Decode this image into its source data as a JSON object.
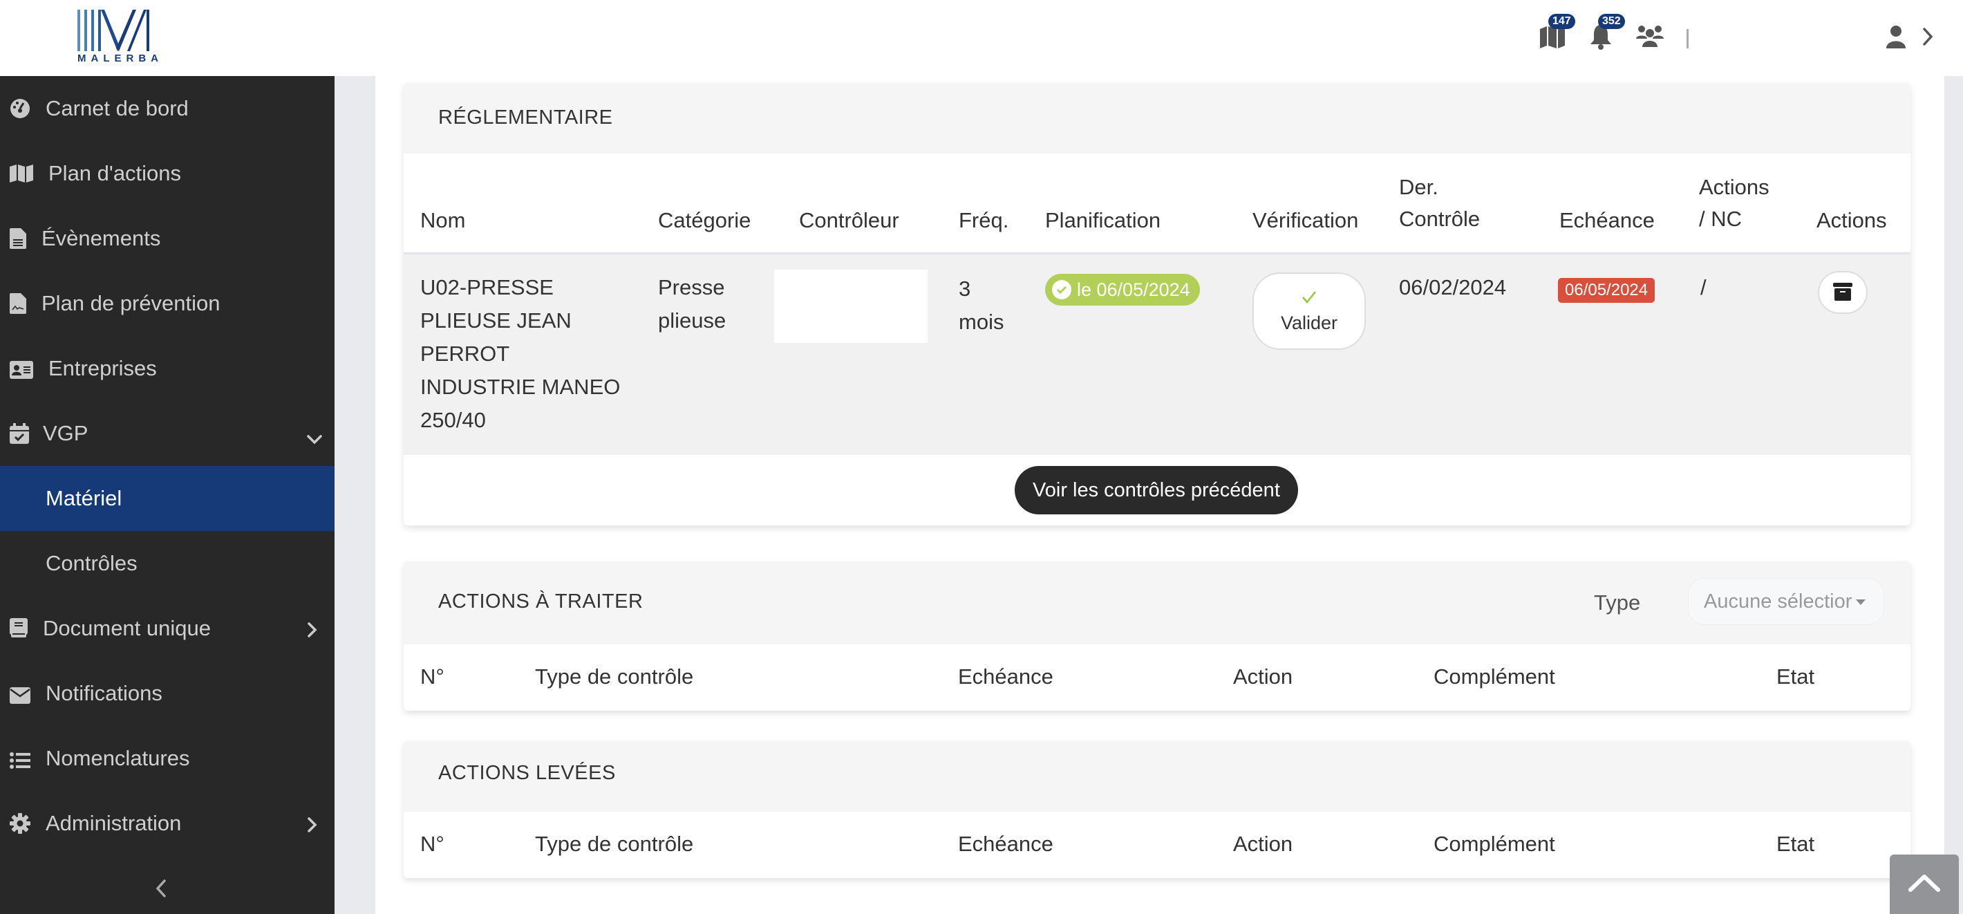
{
  "header": {
    "logo_text": "MALERBA",
    "icons": [
      {
        "name": "map-icon",
        "badge": "147"
      },
      {
        "name": "bell-icon",
        "badge": "352"
      },
      {
        "name": "users-icon",
        "badge": null
      }
    ],
    "user_icon": "user-icon",
    "user_chevron": "chevron-right-icon"
  },
  "sidebar": {
    "items": [
      {
        "label": "Carnet de bord",
        "icon": "dashboard-icon"
      },
      {
        "label": "Plan d'actions",
        "icon": "map-icon"
      },
      {
        "label": "Évènements",
        "icon": "file-text-icon"
      },
      {
        "label": "Plan de prévention",
        "icon": "file-signature-icon"
      },
      {
        "label": "Entreprises",
        "icon": "id-card-icon"
      },
      {
        "label": "VGP",
        "icon": "calendar-check-icon",
        "expanded": true
      },
      {
        "label": "Matériel",
        "sub": true,
        "active": true
      },
      {
        "label": "Contrôles",
        "sub": true
      },
      {
        "label": "Document unique",
        "icon": "book-icon",
        "has_children": true
      },
      {
        "label": "Notifications",
        "icon": "envelope-icon"
      },
      {
        "label": "Nomenclatures",
        "icon": "list-icon"
      },
      {
        "label": "Administration",
        "icon": "gear-icon",
        "has_children": true
      }
    ],
    "collapse_icon": "chevron-left-icon"
  },
  "reglementaire": {
    "title": "RÉGLEMENTAIRE",
    "columns": [
      "Nom",
      "Catégorie",
      "Contrôleur",
      "Fréq.",
      "Planification",
      "Vérification",
      "Der.\nContrôle",
      "Echéance",
      "Actions\n/ NC",
      "Actions"
    ],
    "row": {
      "nom": "U02-PRESSE PLIEUSE JEAN PERROT INDUSTRIE MANEO 250/40",
      "nom_lines": [
        "U02-PRESSE",
        "PLIEUSE JEAN",
        "PERROT",
        "INDUSTRIE MANEO",
        "250/40"
      ],
      "categorie_lines": [
        "Presse",
        "plieuse"
      ],
      "controleur": "",
      "freq_lines": [
        "3",
        "mois"
      ],
      "planification": "le 06/05/2024",
      "verification_label": "Valider",
      "der_controle": "06/02/2024",
      "echeance": "06/05/2024",
      "actions_nc": "/",
      "actions_icon": "archive-icon"
    },
    "footer_button": "Voir les contrôles précédent",
    "colors": {
      "planification_badge": "#b2d057",
      "echeance_badge": "#d94f3d"
    }
  },
  "actions_a_traiter": {
    "title": "ACTIONS À TRAITER",
    "type_label": "Type",
    "type_select_value": "Aucune sélection",
    "type_select_display": "Aucune sélectior",
    "columns": [
      "N°",
      "Type de contrôle",
      "Echéance",
      "Action",
      "Complément",
      "Etat"
    ]
  },
  "actions_levees": {
    "title": "ACTIONS LEVÉES",
    "columns": [
      "N°",
      "Type de contrôle",
      "Echéance",
      "Action",
      "Complément",
      "Etat"
    ]
  },
  "scroll_top_icon": "chevron-up-icon",
  "colors": {
    "sidebar_bg": "#282828",
    "active_item": "#163a78",
    "brand_blue": "#1b3a78"
  }
}
